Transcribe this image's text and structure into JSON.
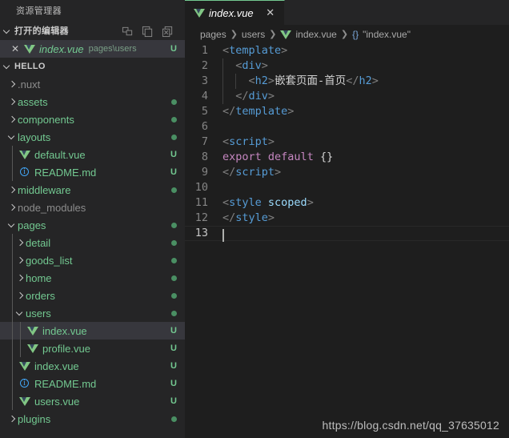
{
  "sidebar": {
    "title": "资源管理器",
    "open_editors": {
      "label": "打开的编辑器",
      "actions": [
        {
          "name": "split-editor-icon",
          "title": "拆分编辑器"
        },
        {
          "name": "save-all-icon",
          "title": "全部保存"
        },
        {
          "name": "close-all-icon",
          "title": "全部关闭"
        }
      ],
      "rows": [
        {
          "close": "✕",
          "icon": "vue-file-icon",
          "name": "index.vue",
          "description": "pages\\users",
          "git_status": "U",
          "selected": true
        }
      ]
    },
    "folder": {
      "label": "HELLO",
      "expanded": true
    },
    "tree": [
      {
        "label": ".nuxt",
        "type": "folder",
        "depth": 1,
        "expanded": false,
        "ignored": true,
        "badge": ""
      },
      {
        "label": "assets",
        "type": "folder",
        "depth": 1,
        "expanded": false,
        "ignored": false,
        "badge": "dot"
      },
      {
        "label": "components",
        "type": "folder",
        "depth": 1,
        "expanded": false,
        "ignored": false,
        "badge": "dot"
      },
      {
        "label": "layouts",
        "type": "folder",
        "depth": 1,
        "expanded": true,
        "ignored": false,
        "badge": "dot"
      },
      {
        "label": "default.vue",
        "type": "vue",
        "depth": 2,
        "ignored": false,
        "badge": "U"
      },
      {
        "label": "README.md",
        "type": "md",
        "depth": 2,
        "ignored": false,
        "badge": "U"
      },
      {
        "label": "middleware",
        "type": "folder",
        "depth": 1,
        "expanded": false,
        "ignored": false,
        "badge": "dot"
      },
      {
        "label": "node_modules",
        "type": "folder",
        "depth": 1,
        "expanded": false,
        "ignored": true,
        "badge": ""
      },
      {
        "label": "pages",
        "type": "folder",
        "depth": 1,
        "expanded": true,
        "ignored": false,
        "badge": "dot"
      },
      {
        "label": "detail",
        "type": "folder",
        "depth": 2,
        "expanded": false,
        "ignored": false,
        "badge": "dot"
      },
      {
        "label": "goods_list",
        "type": "folder",
        "depth": 2,
        "expanded": false,
        "ignored": false,
        "badge": "dot"
      },
      {
        "label": "home",
        "type": "folder",
        "depth": 2,
        "expanded": false,
        "ignored": false,
        "badge": "dot"
      },
      {
        "label": "orders",
        "type": "folder",
        "depth": 2,
        "expanded": false,
        "ignored": false,
        "badge": "dot"
      },
      {
        "label": "users",
        "type": "folder",
        "depth": 2,
        "expanded": true,
        "ignored": false,
        "badge": "dot"
      },
      {
        "label": "index.vue",
        "type": "vue",
        "depth": 3,
        "ignored": false,
        "badge": "U",
        "selected": true
      },
      {
        "label": "profile.vue",
        "type": "vue",
        "depth": 3,
        "ignored": false,
        "badge": "U"
      },
      {
        "label": "index.vue",
        "type": "vue",
        "depth": 2,
        "ignored": false,
        "badge": "U"
      },
      {
        "label": "README.md",
        "type": "md",
        "depth": 2,
        "ignored": false,
        "badge": "U"
      },
      {
        "label": "users.vue",
        "type": "vue",
        "depth": 2,
        "ignored": false,
        "badge": "U"
      },
      {
        "label": "plugins",
        "type": "folder",
        "depth": 1,
        "expanded": false,
        "ignored": false,
        "badge": "dot"
      }
    ]
  },
  "editor": {
    "tab": {
      "icon": "vue-file-icon",
      "label": "index.vue",
      "close": "✕",
      "modified_italic": true
    },
    "breadcrumbs": [
      {
        "label": "pages",
        "icon": ""
      },
      {
        "label": "users",
        "icon": ""
      },
      {
        "label": "index.vue",
        "icon": "vue-file-icon"
      },
      {
        "label": "\"index.vue\"",
        "icon": "{}"
      }
    ],
    "breadcrumb_separator": "❯",
    "lines": [
      {
        "n": "1",
        "indent_guides": 0,
        "tokens": [
          {
            "t": "<",
            "c": "punct"
          },
          {
            "t": "template",
            "c": "tag"
          },
          {
            "t": ">",
            "c": "punct"
          }
        ]
      },
      {
        "n": "2",
        "indent_guides": 1,
        "tokens": [
          {
            "t": "  ",
            "c": "text"
          },
          {
            "t": "<",
            "c": "punct"
          },
          {
            "t": "div",
            "c": "tag"
          },
          {
            "t": ">",
            "c": "punct"
          }
        ]
      },
      {
        "n": "3",
        "indent_guides": 2,
        "tokens": [
          {
            "t": "    ",
            "c": "text"
          },
          {
            "t": "<",
            "c": "punct"
          },
          {
            "t": "h2",
            "c": "tag"
          },
          {
            "t": ">",
            "c": "punct"
          },
          {
            "t": "嵌套页面-首页",
            "c": "text"
          },
          {
            "t": "</",
            "c": "punct"
          },
          {
            "t": "h2",
            "c": "tag"
          },
          {
            "t": ">",
            "c": "punct"
          }
        ]
      },
      {
        "n": "4",
        "indent_guides": 1,
        "tokens": [
          {
            "t": "  ",
            "c": "text"
          },
          {
            "t": "</",
            "c": "punct"
          },
          {
            "t": "div",
            "c": "tag"
          },
          {
            "t": ">",
            "c": "punct"
          }
        ]
      },
      {
        "n": "5",
        "indent_guides": 0,
        "tokens": [
          {
            "t": "</",
            "c": "punct"
          },
          {
            "t": "template",
            "c": "tag"
          },
          {
            "t": ">",
            "c": "punct"
          }
        ]
      },
      {
        "n": "6",
        "indent_guides": 0,
        "tokens": []
      },
      {
        "n": "7",
        "indent_guides": 0,
        "tokens": [
          {
            "t": "<",
            "c": "punct"
          },
          {
            "t": "script",
            "c": "tag"
          },
          {
            "t": ">",
            "c": "punct"
          }
        ]
      },
      {
        "n": "8",
        "indent_guides": 0,
        "tokens": [
          {
            "t": "export",
            "c": "kw"
          },
          {
            "t": " ",
            "c": "text"
          },
          {
            "t": "default",
            "c": "kw"
          },
          {
            "t": " ",
            "c": "text"
          },
          {
            "t": "{}",
            "c": "brace"
          }
        ]
      },
      {
        "n": "9",
        "indent_guides": 0,
        "tokens": [
          {
            "t": "</",
            "c": "punct"
          },
          {
            "t": "script",
            "c": "tag"
          },
          {
            "t": ">",
            "c": "punct"
          }
        ]
      },
      {
        "n": "10",
        "indent_guides": 0,
        "tokens": []
      },
      {
        "n": "11",
        "indent_guides": 0,
        "tokens": [
          {
            "t": "<",
            "c": "punct"
          },
          {
            "t": "style",
            "c": "tag"
          },
          {
            "t": " ",
            "c": "text"
          },
          {
            "t": "scoped",
            "c": "attr"
          },
          {
            "t": ">",
            "c": "punct"
          }
        ]
      },
      {
        "n": "12",
        "indent_guides": 0,
        "tokens": [
          {
            "t": "</",
            "c": "punct"
          },
          {
            "t": "style",
            "c": "tag"
          },
          {
            "t": ">",
            "c": "punct"
          }
        ]
      },
      {
        "n": "13",
        "indent_guides": 0,
        "tokens": [],
        "cursor": true,
        "current": true
      }
    ]
  },
  "watermark": "https://blog.csdn.net/qq_37635012",
  "colors": {
    "sidebar_bg": "#252526",
    "editor_bg": "#1e1e1e",
    "selection_bg": "#37373d",
    "git_untracked": "#73c991",
    "git_ignored": "#8c8c8c",
    "tag": "#569cd6",
    "keyword": "#c586c0",
    "attribute": "#9cdcfe",
    "punctuation": "#808080",
    "line_number": "#858585",
    "tab_accent": "#73c991"
  }
}
